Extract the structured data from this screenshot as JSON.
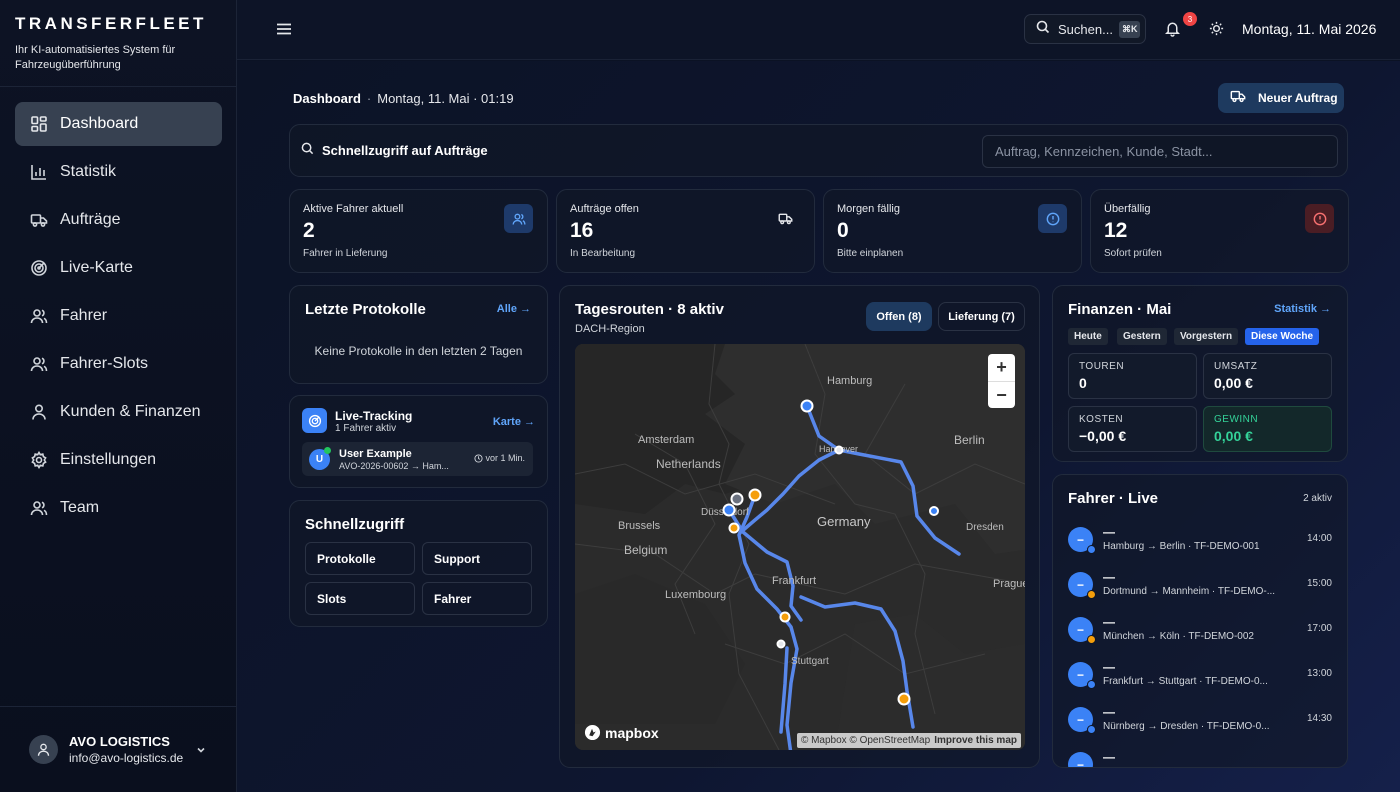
{
  "brand": {
    "name": "TRANSFERFLEET",
    "tagline": "Ihr KI-automatisiertes System für Fahrzeugüberführung"
  },
  "nav": [
    {
      "label": "Dashboard",
      "icon": "grid-icon",
      "active": true
    },
    {
      "label": "Statistik",
      "icon": "bar-chart-icon"
    },
    {
      "label": "Aufträge",
      "icon": "truck-icon"
    },
    {
      "label": "Live-Karte",
      "icon": "radar-icon"
    },
    {
      "label": "Fahrer",
      "icon": "users-icon"
    },
    {
      "label": "Fahrer-Slots",
      "icon": "users-icon"
    },
    {
      "label": "Kunden & Finanzen",
      "icon": "user-icon"
    },
    {
      "label": "Einstellungen",
      "icon": "gear-icon"
    },
    {
      "label": "Team",
      "icon": "users-icon"
    }
  ],
  "account": {
    "company": "AVO LOGISTICS",
    "email": "info@avo-logistics.de"
  },
  "topbar": {
    "search_label": "Suchen...",
    "shortcut": "⌘K",
    "notifications": "3",
    "date": "Montag, 11. Mai 2026"
  },
  "breadcrumb": {
    "page": "Dashboard",
    "datetime": "Montag, 11. Mai · 01:19"
  },
  "new_order_label": "Neuer Auftrag",
  "quick_access": {
    "label": "Schnellzugriff auf Aufträge",
    "placeholder": "Auftrag, Kennzeichen, Kunde, Stadt..."
  },
  "stats": [
    {
      "title": "Aktive Fahrer aktuell",
      "value": "2",
      "sub": "Fahrer in Lieferung",
      "icon": "users-icon",
      "color": "#3b82f6"
    },
    {
      "title": "Aufträge offen",
      "value": "16",
      "sub": "In Bearbeitung",
      "icon": "truck-icon",
      "color": "#e5e7eb"
    },
    {
      "title": "Morgen fällig",
      "value": "0",
      "sub": "Bitte einplanen",
      "icon": "alert-circle-icon",
      "color": "#3b82f6"
    },
    {
      "title": "Überfällig",
      "value": "12",
      "sub": "Sofort prüfen",
      "icon": "alert-circle-icon",
      "color": "#ef4444"
    }
  ],
  "protocols": {
    "title": "Letzte Protokolle",
    "link": "Alle →",
    "empty": "Keine Protokolle in den letzten 2 Tagen"
  },
  "live_tracking": {
    "title": "Live-Tracking",
    "sub": "1 Fahrer aktiv",
    "link": "Karte →",
    "entry": {
      "initial": "U",
      "name": "User Example",
      "route": "AVO-2026-00602 → Ham...",
      "time": "vor 1 Min."
    }
  },
  "quick": {
    "title": "Schnellzugriff",
    "buttons": [
      "Protokolle",
      "Support",
      "Slots",
      "Fahrer"
    ]
  },
  "routes": {
    "title": "Tagesrouten · 8 aktiv",
    "sub": "DACH-Region",
    "tab_open": "Offen (8)",
    "tab_delivery": "Lieferung (7)",
    "map_labels": [
      "Hamburg",
      "Berlin",
      "Amsterdam",
      "Netherlands",
      "Hannover",
      "Düsseldorf",
      "Germany",
      "Dresden",
      "Brussels",
      "Belgium",
      "Frankfurt",
      "Luxembourg",
      "Stuttgart",
      "Prague"
    ],
    "logo": "mapbox",
    "attribution": "© Mapbox © OpenStreetMap",
    "improve": "Improve this map"
  },
  "finance": {
    "title": "Finanzen · Mai",
    "link": "Statistik →",
    "periods": [
      "Heute",
      "Gestern",
      "Vorgestern",
      "Diese Woche"
    ],
    "active_period": "Diese Woche",
    "kpis": [
      {
        "label": "TOUREN",
        "value": "0"
      },
      {
        "label": "UMSATZ",
        "value": "0,00 €"
      },
      {
        "label": "KOSTEN",
        "value": "−0,00 €"
      },
      {
        "label": "GEWINN",
        "value": "0,00 €"
      }
    ]
  },
  "drivers": {
    "title": "Fahrer · Live",
    "count": "2 aktiv",
    "rows": [
      {
        "name": "—",
        "route": "Hamburg → Berlin · TF-DEMO-001",
        "time": "14:00",
        "status_color": "#3b82f6"
      },
      {
        "name": "—",
        "route": "Dortmund → Mannheim · TF-DEMO-...",
        "time": "15:00",
        "status_color": "#f59e0b"
      },
      {
        "name": "—",
        "route": "München → Köln · TF-DEMO-002",
        "time": "17:00",
        "status_color": "#f59e0b"
      },
      {
        "name": "—",
        "route": "Frankfurt → Stuttgart · TF-DEMO-0...",
        "time": "13:00",
        "status_color": "#3b82f6"
      },
      {
        "name": "—",
        "route": "Nürnberg → Dresden · TF-DEMO-0...",
        "time": "14:30",
        "status_color": "#3b82f6"
      },
      {
        "name": "—",
        "route": "",
        "time": "",
        "status_color": "#3b82f6"
      }
    ]
  }
}
